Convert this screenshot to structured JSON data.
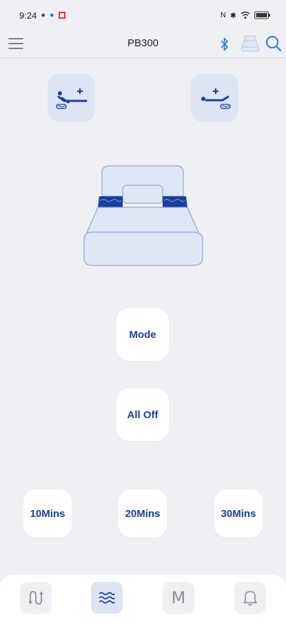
{
  "status_bar": {
    "time": "9:24",
    "battery_icon": "battery-icon",
    "wifi_icon": "wifi-icon",
    "bluetooth_icon": "bluetooth-status-icon"
  },
  "app_bar": {
    "title": "PB300",
    "menu_icon": "hamburger-menu-icon",
    "bluetooth_icon": "bluetooth-icon",
    "device_icon": "bed-icon",
    "search_icon": "search-icon"
  },
  "controls": {
    "head_up_icon": "head-massage-plus-icon",
    "foot_up_icon": "foot-massage-plus-icon",
    "mode_label": "Mode",
    "all_off_label": "All Off",
    "timers": [
      "10Mins",
      "20Mins",
      "30Mins"
    ]
  },
  "bottom_nav": {
    "items": [
      {
        "icon": "adjust-wave-icon",
        "active": false
      },
      {
        "icon": "massage-waves-icon",
        "active": true
      },
      {
        "icon": "memory-m-icon",
        "label": "M",
        "active": false
      },
      {
        "icon": "bell-icon",
        "active": false
      }
    ]
  },
  "colors": {
    "accent": "#1d3f9a",
    "tile_bg": "#dde4f3",
    "page_bg": "#eef0f4",
    "bluetooth": "#2a7ad8"
  }
}
